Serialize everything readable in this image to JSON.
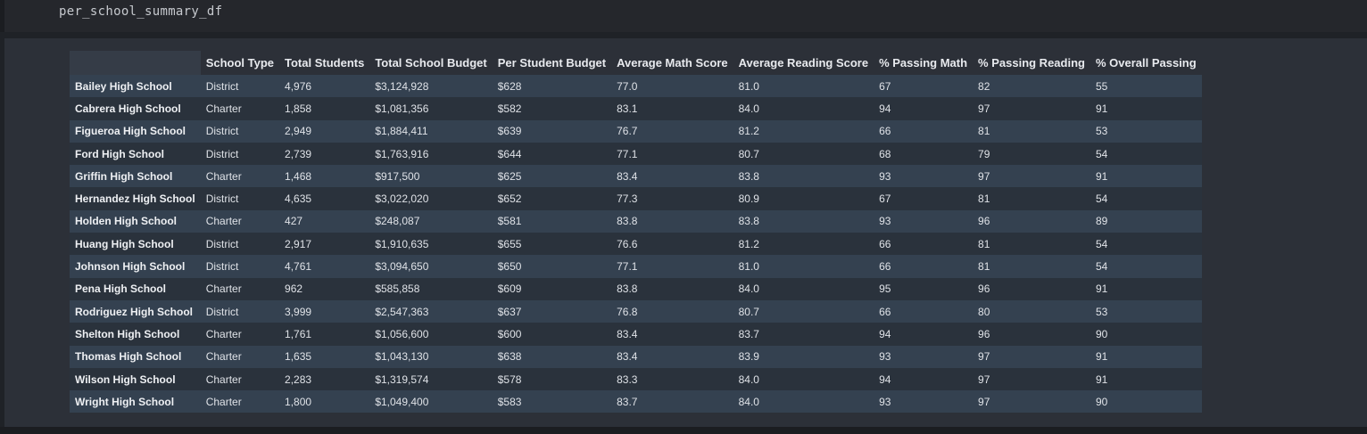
{
  "code_cell": {
    "source": "per_school_summary_df"
  },
  "dataframe": {
    "columns": [
      "School Type",
      "Total Students",
      "Total School Budget",
      "Per Student Budget",
      "Average Math Score",
      "Average Reading Score",
      "% Passing Math",
      "% Passing Reading",
      "% Overall Passing"
    ],
    "rows": [
      {
        "name": "Bailey High School",
        "cells": [
          "District",
          "4,976",
          "$3,124,928",
          "$628",
          "77.0",
          "81.0",
          "67",
          "82",
          "55"
        ]
      },
      {
        "name": "Cabrera High School",
        "cells": [
          "Charter",
          "1,858",
          "$1,081,356",
          "$582",
          "83.1",
          "84.0",
          "94",
          "97",
          "91"
        ]
      },
      {
        "name": "Figueroa High School",
        "cells": [
          "District",
          "2,949",
          "$1,884,411",
          "$639",
          "76.7",
          "81.2",
          "66",
          "81",
          "53"
        ]
      },
      {
        "name": "Ford High School",
        "cells": [
          "District",
          "2,739",
          "$1,763,916",
          "$644",
          "77.1",
          "80.7",
          "68",
          "79",
          "54"
        ]
      },
      {
        "name": "Griffin High School",
        "cells": [
          "Charter",
          "1,468",
          "$917,500",
          "$625",
          "83.4",
          "83.8",
          "93",
          "97",
          "91"
        ]
      },
      {
        "name": "Hernandez High School",
        "cells": [
          "District",
          "4,635",
          "$3,022,020",
          "$652",
          "77.3",
          "80.9",
          "67",
          "81",
          "54"
        ]
      },
      {
        "name": "Holden High School",
        "cells": [
          "Charter",
          "427",
          "$248,087",
          "$581",
          "83.8",
          "83.8",
          "93",
          "96",
          "89"
        ]
      },
      {
        "name": "Huang High School",
        "cells": [
          "District",
          "2,917",
          "$1,910,635",
          "$655",
          "76.6",
          "81.2",
          "66",
          "81",
          "54"
        ]
      },
      {
        "name": "Johnson High School",
        "cells": [
          "District",
          "4,761",
          "$3,094,650",
          "$650",
          "77.1",
          "81.0",
          "66",
          "81",
          "54"
        ]
      },
      {
        "name": "Pena High School",
        "cells": [
          "Charter",
          "962",
          "$585,858",
          "$609",
          "83.8",
          "84.0",
          "95",
          "96",
          "91"
        ]
      },
      {
        "name": "Rodriguez High School",
        "cells": [
          "District",
          "3,999",
          "$2,547,363",
          "$637",
          "76.8",
          "80.7",
          "66",
          "80",
          "53"
        ]
      },
      {
        "name": "Shelton High School",
        "cells": [
          "Charter",
          "1,761",
          "$1,056,600",
          "$600",
          "83.4",
          "83.7",
          "94",
          "96",
          "90"
        ]
      },
      {
        "name": "Thomas High School",
        "cells": [
          "Charter",
          "1,635",
          "$1,043,130",
          "$638",
          "83.4",
          "83.9",
          "93",
          "97",
          "91"
        ]
      },
      {
        "name": "Wilson High School",
        "cells": [
          "Charter",
          "2,283",
          "$1,319,574",
          "$578",
          "83.3",
          "84.0",
          "94",
          "97",
          "91"
        ]
      },
      {
        "name": "Wright High School",
        "cells": [
          "Charter",
          "1,800",
          "$1,049,400",
          "$583",
          "83.7",
          "84.0",
          "93",
          "97",
          "90"
        ]
      }
    ]
  },
  "colors": {
    "page_bg": "#1f2227",
    "output_bg": "#2c3038",
    "row_odd": "#344150",
    "row_even": "#2a323c",
    "text": "#dfe2e7"
  }
}
